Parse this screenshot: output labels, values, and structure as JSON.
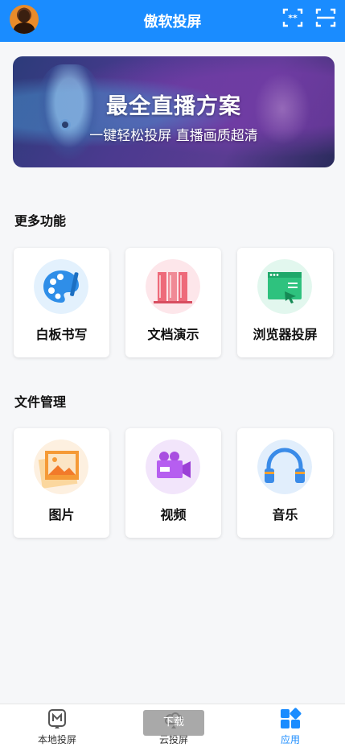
{
  "header": {
    "title": "傲软投屏",
    "avatar_icon": "user-avatar",
    "cast_icon": "screen-cast-icon",
    "scan_icon": "scan-qr-icon",
    "background_color": "#1a8cff"
  },
  "banner": {
    "title": "最全直播方案",
    "subtitle": "一键轻松投屏 直播画质超清"
  },
  "more_functions": {
    "title": "更多功能",
    "items": [
      {
        "label": "白板书写",
        "icon": "palette-icon"
      },
      {
        "label": "文档演示",
        "icon": "document-books-icon"
      },
      {
        "label": "浏览器投屏",
        "icon": "browser-cast-icon"
      }
    ]
  },
  "file_management": {
    "title": "文件管理",
    "items": [
      {
        "label": "图片",
        "icon": "image-icon"
      },
      {
        "label": "视频",
        "icon": "video-camera-icon"
      },
      {
        "label": "音乐",
        "icon": "headphones-icon"
      }
    ]
  },
  "bottom_nav": {
    "items": [
      {
        "label": "本地投屏",
        "icon": "local-cast-icon",
        "active": false
      },
      {
        "label": "云投屏",
        "icon": "cloud-cast-icon",
        "active": false
      },
      {
        "label": "应用",
        "icon": "apps-grid-icon",
        "active": true
      }
    ],
    "active_color": "#1a8cff"
  },
  "toast": {
    "text": "下载"
  }
}
